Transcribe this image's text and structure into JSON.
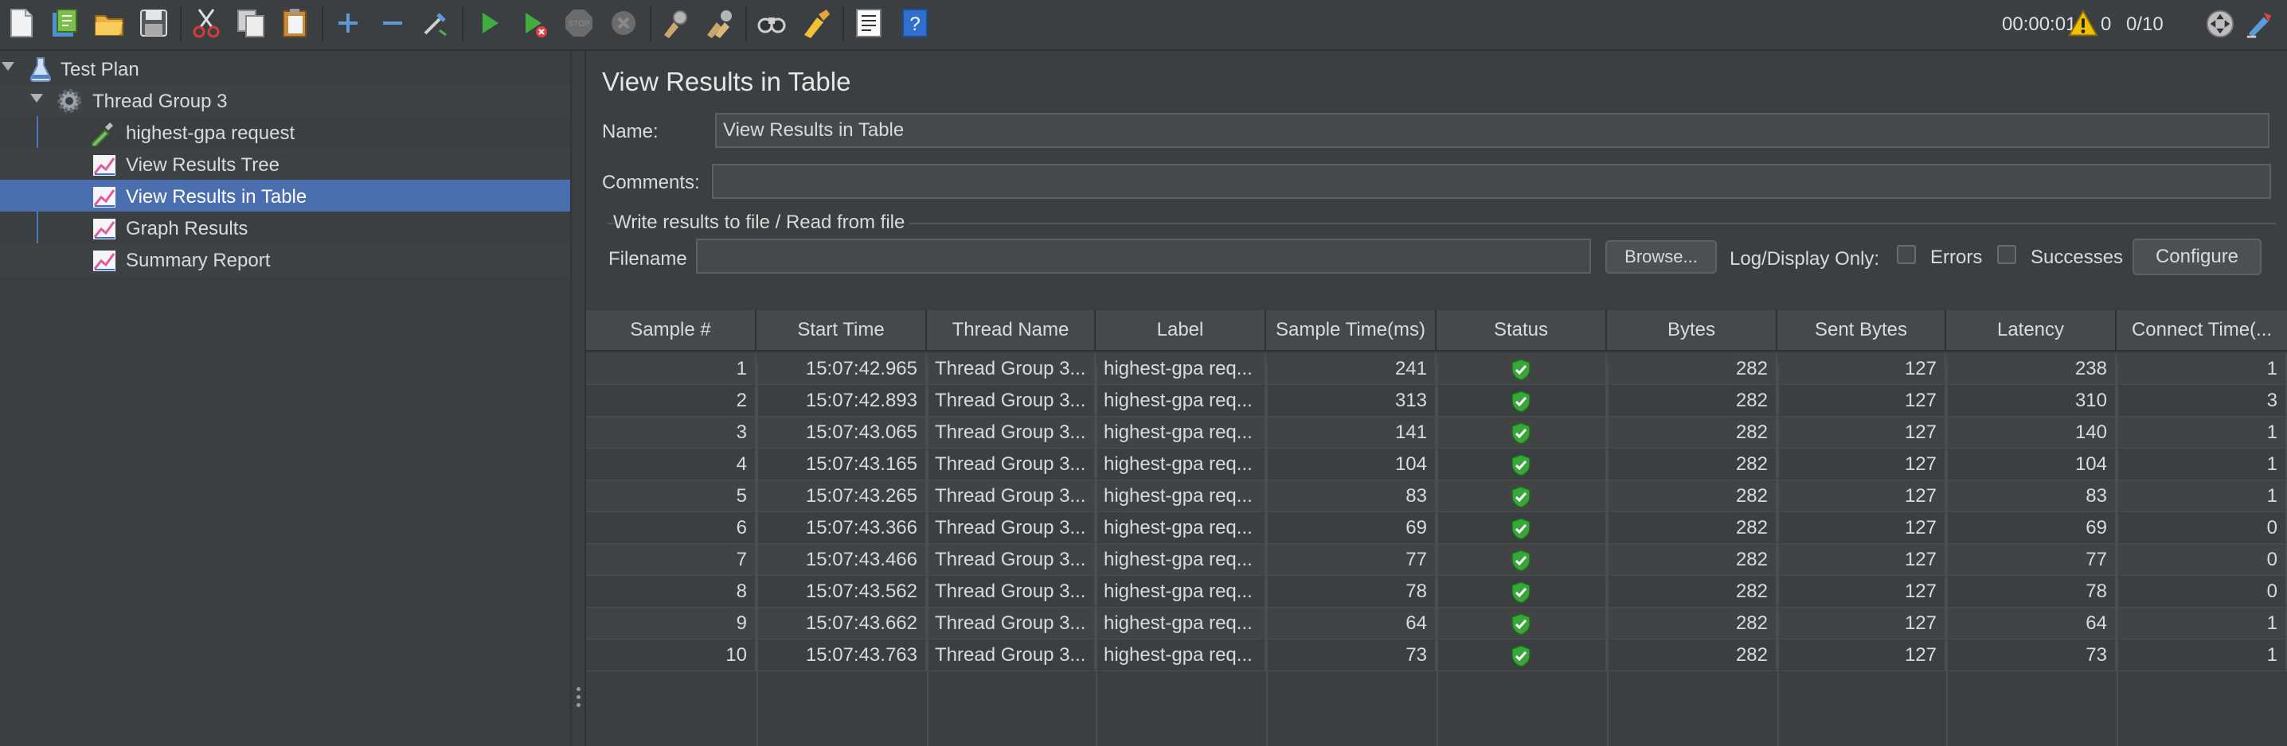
{
  "toolbar": {
    "timer": "00:00:01",
    "warning_count": "0",
    "thread_count": "0/10",
    "icons": [
      "new-icon",
      "templates-icon",
      "open-icon",
      "save-icon",
      "cut-icon",
      "copy-icon",
      "paste-icon",
      "expand-icon",
      "collapse-icon",
      "toggle-icon",
      "start-icon",
      "start-no-pauses-icon",
      "stop-icon",
      "shutdown-icon",
      "clear-icon",
      "clear-all-icon",
      "search-icon",
      "reset-search-icon",
      "function-helper-icon",
      "help-icon"
    ]
  },
  "tree": {
    "items": [
      {
        "label": "Test Plan",
        "icon": "flask-icon"
      },
      {
        "label": "Thread Group 3",
        "icon": "gear-icon"
      },
      {
        "label": "highest-gpa request",
        "icon": "pipette-icon"
      },
      {
        "label": "View Results Tree",
        "icon": "chart-icon"
      },
      {
        "label": "View Results in Table",
        "icon": "chart-icon"
      },
      {
        "label": "Graph Results",
        "icon": "chart-icon"
      },
      {
        "label": "Summary Report",
        "icon": "chart-icon"
      }
    ]
  },
  "panel": {
    "title": "View Results in Table",
    "name_label": "Name:",
    "name_value": "View Results in Table",
    "comments_label": "Comments:",
    "comments_value": "",
    "group_title": "Write results to file / Read from file",
    "filename_label": "Filename",
    "filename_value": "",
    "browse_label": "Browse...",
    "log_display_label": "Log/Display Only:",
    "errors_label": "Errors",
    "successes_label": "Successes",
    "configure_label": "Configure"
  },
  "table": {
    "headers": [
      "Sample #",
      "Start Time",
      "Thread Name",
      "Label",
      "Sample Time(ms)",
      "Status",
      "Bytes",
      "Sent Bytes",
      "Latency",
      "Connect Time(..."
    ],
    "rows": [
      [
        "1",
        "15:07:42.965",
        "Thread Group 3...",
        "highest-gpa req...",
        "241",
        "success",
        "282",
        "127",
        "238",
        "1"
      ],
      [
        "2",
        "15:07:42.893",
        "Thread Group 3...",
        "highest-gpa req...",
        "313",
        "success",
        "282",
        "127",
        "310",
        "3"
      ],
      [
        "3",
        "15:07:43.065",
        "Thread Group 3...",
        "highest-gpa req...",
        "141",
        "success",
        "282",
        "127",
        "140",
        "1"
      ],
      [
        "4",
        "15:07:43.165",
        "Thread Group 3...",
        "highest-gpa req...",
        "104",
        "success",
        "282",
        "127",
        "104",
        "1"
      ],
      [
        "5",
        "15:07:43.265",
        "Thread Group 3...",
        "highest-gpa req...",
        "83",
        "success",
        "282",
        "127",
        "83",
        "1"
      ],
      [
        "6",
        "15:07:43.366",
        "Thread Group 3...",
        "highest-gpa req...",
        "69",
        "success",
        "282",
        "127",
        "69",
        "0"
      ],
      [
        "7",
        "15:07:43.466",
        "Thread Group 3...",
        "highest-gpa req...",
        "77",
        "success",
        "282",
        "127",
        "77",
        "0"
      ],
      [
        "8",
        "15:07:43.562",
        "Thread Group 3...",
        "highest-gpa req...",
        "78",
        "success",
        "282",
        "127",
        "78",
        "0"
      ],
      [
        "9",
        "15:07:43.662",
        "Thread Group 3...",
        "highest-gpa req...",
        "64",
        "success",
        "282",
        "127",
        "64",
        "1"
      ],
      [
        "10",
        "15:07:43.763",
        "Thread Group 3...",
        "highest-gpa req...",
        "73",
        "success",
        "282",
        "127",
        "73",
        "1"
      ]
    ]
  },
  "colors": {
    "background": "#3c3f41",
    "selection": "#4b6eaf",
    "success": "#3aa63a",
    "warning": "#f0c000"
  }
}
